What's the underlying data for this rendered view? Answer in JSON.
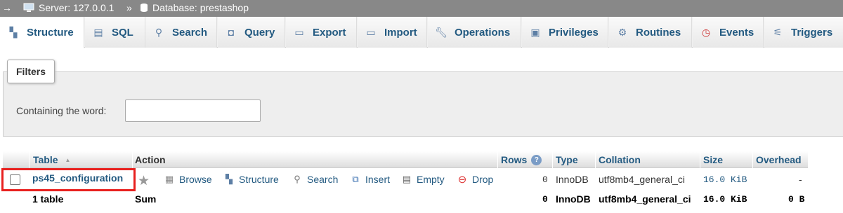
{
  "breadcrumb": {
    "arrow": "→",
    "server": "Server: 127.0.0.1",
    "separator": "»",
    "database": "Database: prestashop"
  },
  "tabs": [
    {
      "label": "Structure",
      "icon": "structure-icon",
      "active": true
    },
    {
      "label": "SQL",
      "icon": "sql-icon"
    },
    {
      "label": "Search",
      "icon": "search-icon"
    },
    {
      "label": "Query",
      "icon": "query-icon"
    },
    {
      "label": "Export",
      "icon": "export-icon"
    },
    {
      "label": "Import",
      "icon": "import-icon"
    },
    {
      "label": "Operations",
      "icon": "wrench-icon"
    },
    {
      "label": "Privileges",
      "icon": "privileges-icon"
    },
    {
      "label": "Routines",
      "icon": "routines-icon"
    },
    {
      "label": "Events",
      "icon": "clock-icon"
    },
    {
      "label": "Triggers",
      "icon": "triggers-icon"
    }
  ],
  "filters": {
    "legend": "Filters",
    "label": "Containing the word:",
    "value": ""
  },
  "table": {
    "headers": {
      "table": "Table",
      "action": "Action",
      "rows": "Rows",
      "type": "Type",
      "collation": "Collation",
      "size": "Size",
      "overhead": "Overhead"
    },
    "row": {
      "name": "ps45_configuration",
      "actions": {
        "browse": "Browse",
        "structure": "Structure",
        "search": "Search",
        "insert": "Insert",
        "empty": "Empty",
        "drop": "Drop"
      },
      "rows": "0",
      "type": "InnoDB",
      "collation": "utf8mb4_general_ci",
      "size": "16.0 KiB",
      "overhead": "-"
    },
    "footer": {
      "count": "1 table",
      "sum": "Sum",
      "rows": "0",
      "type": "InnoDB",
      "collation": "utf8mb4_general_ci",
      "size": "16.0 KiB",
      "overhead": "0 B"
    }
  },
  "colors": {
    "link": "#235a81",
    "highlight": "#e8201e",
    "topbar": "#888888"
  }
}
